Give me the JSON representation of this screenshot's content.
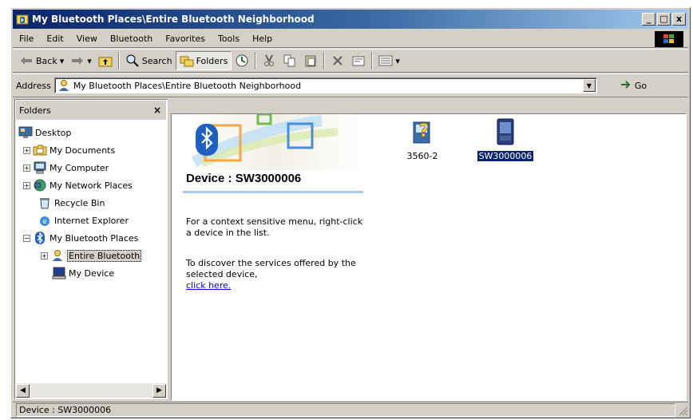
{
  "window": {
    "title": "My Bluetooth Places\\Entire Bluetooth Neighborhood",
    "buttons": {
      "minimize": "_",
      "maximize": "□",
      "close": "x"
    }
  },
  "menu": {
    "items": [
      {
        "label": "File"
      },
      {
        "label": "Edit"
      },
      {
        "label": "View"
      },
      {
        "label": "Bluetooth"
      },
      {
        "label": "Favorites"
      },
      {
        "label": "Tools"
      },
      {
        "label": "Help"
      }
    ]
  },
  "toolbar": {
    "back_label": "Back",
    "search_label": "Search",
    "folders_label": "Folders"
  },
  "address": {
    "label": "Address",
    "value": "My Bluetooth Places\\Entire Bluetooth Neighborhood",
    "go_label": "Go"
  },
  "folders": {
    "title": "Folders",
    "close": "×",
    "tree": [
      {
        "label": "Desktop",
        "icon": "desktop-icon"
      },
      {
        "label": "My Documents",
        "icon": "folder-icon",
        "expander": "+"
      },
      {
        "label": "My Computer",
        "icon": "computer-icon",
        "expander": "+"
      },
      {
        "label": "My Network Places",
        "icon": "network-icon",
        "expander": "+"
      },
      {
        "label": "Recycle Bin",
        "icon": "recycle-bin-icon"
      },
      {
        "label": "Internet Explorer",
        "icon": "internet-explorer-icon"
      },
      {
        "label": "My Bluetooth Places",
        "icon": "bluetooth-icon",
        "expander": "−"
      },
      {
        "label": "Entire Bluetooth",
        "icon": "bluetooth-neighborhood-icon",
        "expander": "+",
        "selected": true
      },
      {
        "label": "My Device",
        "icon": "my-device-icon"
      }
    ]
  },
  "webview": {
    "device_title": "Device : SW3000006",
    "context_text": "For a context sensitive menu, right-click a device in the list.",
    "discover_text": "To discover the services offered by the selected device,",
    "discover_link": "click here."
  },
  "devices": [
    {
      "label": "3560-2",
      "icon": "unknown-device-icon",
      "selected": false
    },
    {
      "label": "SW3000006",
      "icon": "pda-device-icon",
      "selected": true
    }
  ],
  "status": {
    "text": "Device : SW3000006"
  },
  "colors": {
    "titlebar_start": "#0a246a",
    "titlebar_end": "#a6caf0",
    "window_face": "#d4d0c8",
    "link": "#0000ff",
    "selection": "#0a246a"
  }
}
